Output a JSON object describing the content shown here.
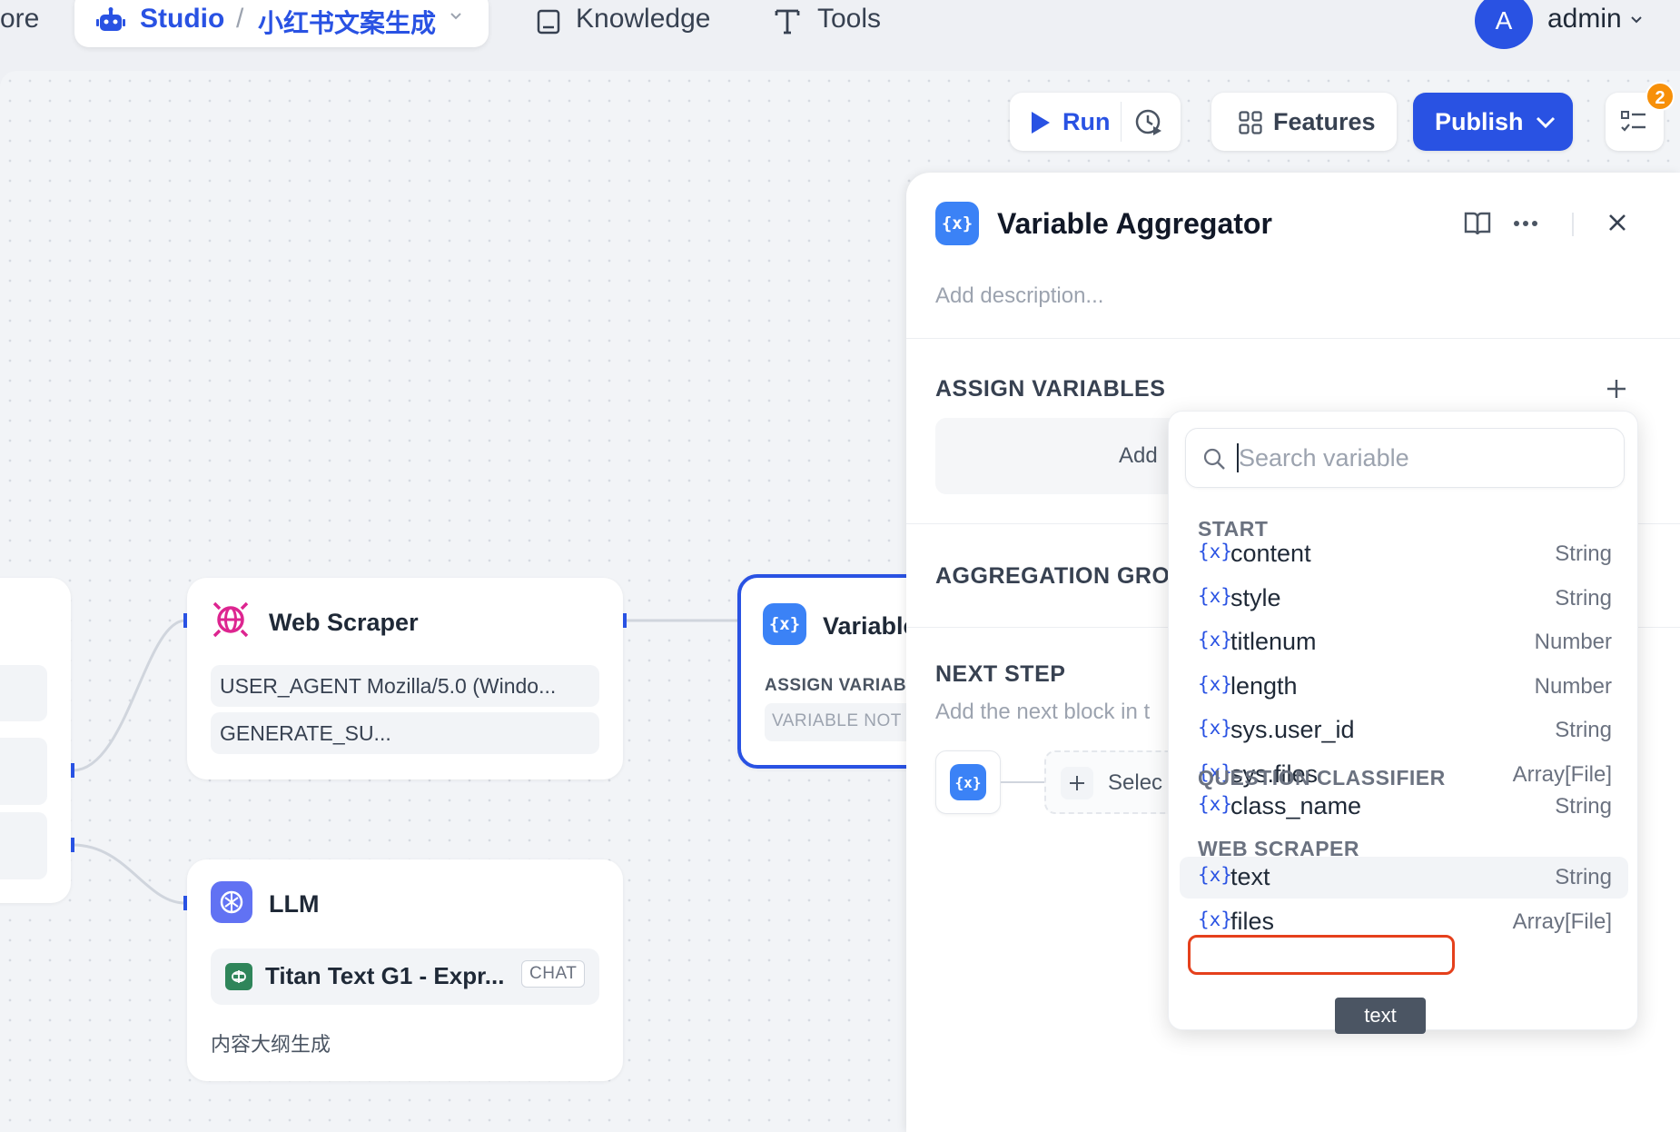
{
  "topnav": {
    "explore_partial": "ore",
    "studio_label": "Studio",
    "separator": "/",
    "app_name": "小红书文案生成",
    "knowledge_label": "Knowledge",
    "tools_label": "Tools",
    "avatar_initial": "A",
    "user_name": "admin"
  },
  "toolbar": {
    "run_label": "Run",
    "features_label": "Features",
    "publish_label": "Publish",
    "checklist_badge": "2"
  },
  "nodes": {
    "web_scraper": {
      "title": "Web Scraper",
      "rows": [
        "USER_AGENT Mozilla/5.0 (Windo...",
        "GENERATE_SU..."
      ]
    },
    "llm": {
      "title": "LLM",
      "model": "Titan Text G1 - Expr...",
      "mode_badge": "CHAT",
      "description": "内容大纲生成"
    },
    "variable": {
      "title": "Variable",
      "assign_label": "ASSIGN VARIAB",
      "not_label": "VARIABLE NOT"
    }
  },
  "panel": {
    "title": "Variable Aggregator",
    "description_placeholder": "Add description...",
    "assign_variables": "ASSIGN VARIABLES",
    "add_partial": "Add",
    "aggregation_group": "AGGREGATION GROU",
    "next_step": "NEXT STEP",
    "next_step_desc": "Add the next block in t",
    "select_partial": "Selec"
  },
  "dropdown": {
    "search_placeholder": "Search variable",
    "var_icon_text": "{x}",
    "groups": [
      {
        "label": "START",
        "items": [
          {
            "name": "content",
            "type": "String"
          },
          {
            "name": "style",
            "type": "String"
          },
          {
            "name": "titlenum",
            "type": "Number"
          },
          {
            "name": "length",
            "type": "Number"
          },
          {
            "name": "sys.user_id",
            "type": "String"
          },
          {
            "name": "sys.files",
            "type": "Array[File]"
          }
        ]
      },
      {
        "label": "QUESTION CLASSIFIER",
        "items": [
          {
            "name": "class_name",
            "type": "String"
          }
        ]
      },
      {
        "label": "WEB SCRAPER",
        "items": [
          {
            "name": "text",
            "type": "String"
          },
          {
            "name": "files",
            "type": "Array[File]"
          }
        ]
      }
    ],
    "tooltip": "text"
  },
  "colors": {
    "brand_blue": "#2952e3",
    "variable_icon_blue": "#3b82f6",
    "llm_purple": "#6172f3",
    "scraper_pink": "#dd2590",
    "highlight_red": "#e5401c"
  }
}
